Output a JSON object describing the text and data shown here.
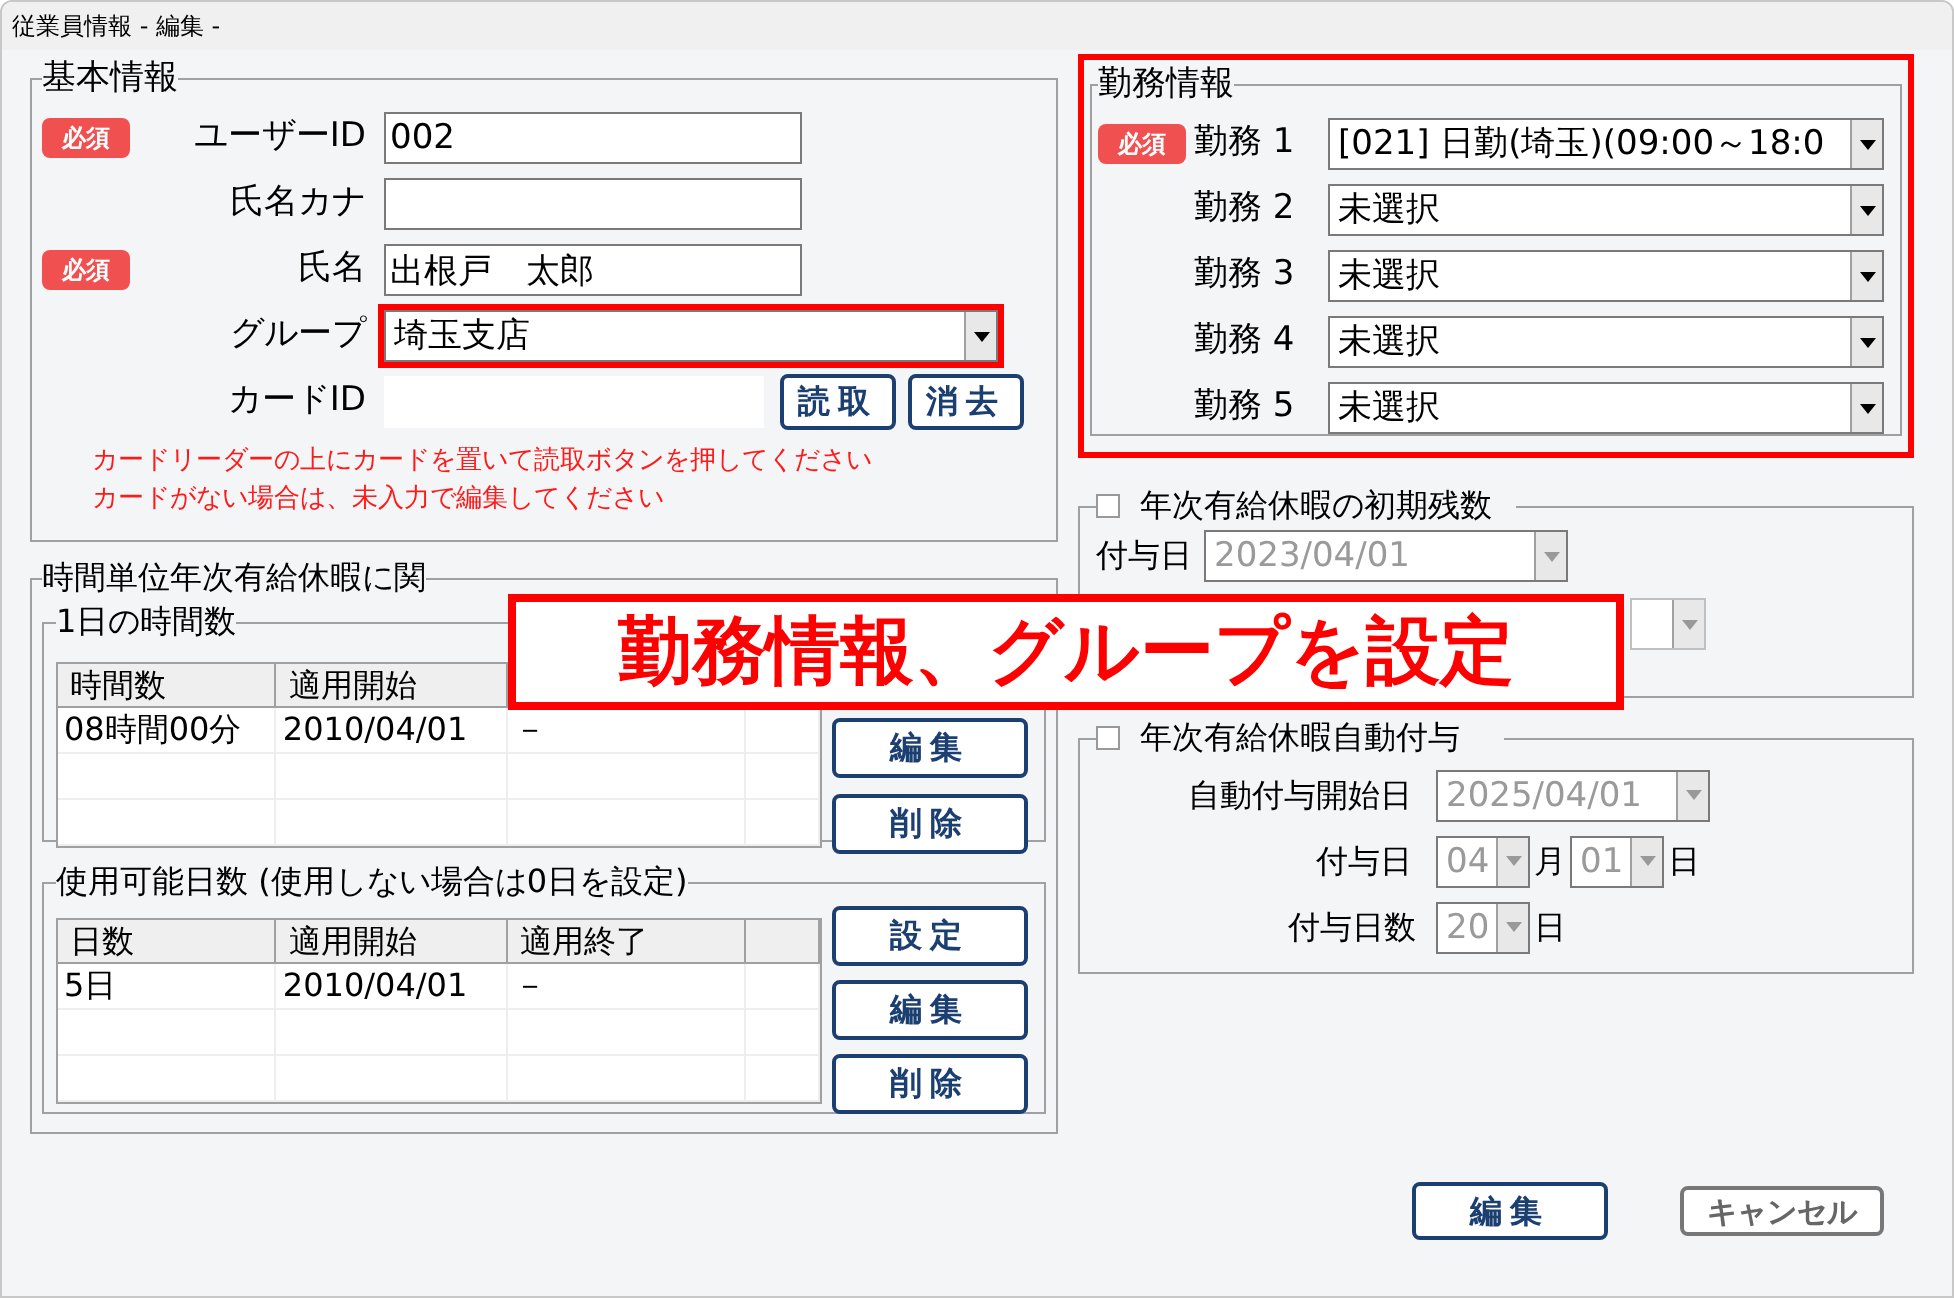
{
  "window": {
    "title": "従業員情報 - 編集 -"
  },
  "basic_info": {
    "title": "基本情報",
    "fields": [
      {
        "kind": "text",
        "label": "ユーザーID",
        "badge": "必須",
        "value": "002"
      },
      {
        "kind": "text",
        "label": "氏名カナ"
      },
      {
        "kind": "text",
        "label": "氏名",
        "badge": "必須",
        "value": "出根戸　太郎"
      },
      {
        "kind": "select",
        "label": "グループ",
        "value": "埼玉支店",
        "highlighted": true
      },
      {
        "kind": "card",
        "label": "カードID",
        "buttons": [
          "読取",
          "消去"
        ]
      }
    ],
    "notes": [
      "カードリーダーの上にカードを置いて読取ボタンを押してください",
      "カードがない場合は、未入力で編集してください"
    ]
  },
  "hourly_leave": {
    "title": "時間単位年次有給休暇に関",
    "hours_per_day": {
      "title": "1日の時間数",
      "columns": [
        "時間数",
        "適用開始"
      ],
      "rows": [
        [
          "08時間00分",
          "2010/04/01",
          "－"
        ]
      ],
      "buttons": [
        "編集",
        "削除"
      ]
    },
    "usable_days": {
      "title": "使用可能日数 (使用しない場合は0日を設定)",
      "columns": [
        "日数",
        "適用開始",
        "適用終了"
      ],
      "rows": [
        [
          "5日",
          "2010/04/01",
          "－"
        ]
      ],
      "buttons": [
        "設定",
        "編集",
        "削除"
      ]
    }
  },
  "work_info": {
    "title": "勤務情報",
    "highlighted": true,
    "shifts": [
      {
        "label": "勤務 1",
        "badge": "必須",
        "value": "[021] 日勤(埼玉)(09:00～18:0"
      },
      {
        "label": "勤務 2",
        "value": "未選択"
      },
      {
        "label": "勤務 3",
        "value": "未選択"
      },
      {
        "label": "勤務 4",
        "value": "未選択"
      },
      {
        "label": "勤務 5",
        "value": "未選択"
      }
    ]
  },
  "initial_balance": {
    "title": "年次有給休暇の初期残数",
    "checked": false,
    "grant_date_label": "付与日",
    "grant_date": "2023/04/01"
  },
  "auto_grant": {
    "title": "年次有給休暇自動付与",
    "checked": false,
    "start_label": "自動付与開始日",
    "start": "2025/04/01",
    "grant_day_label": "付与日",
    "month": "04",
    "month_unit": "月",
    "day": "01",
    "day_unit": "日",
    "days_label": "付与日数",
    "days": "20",
    "days_unit": "日"
  },
  "callout": "勤務情報、グループを設定",
  "buttons": [
    {
      "label": "編集",
      "kind": "primary"
    },
    {
      "label": "キャンセル",
      "kind": "secondary"
    }
  ]
}
